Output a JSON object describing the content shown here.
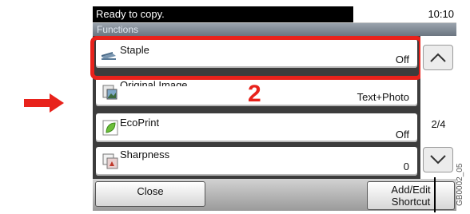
{
  "status": {
    "message": "Ready to copy.",
    "time": "10:10"
  },
  "header": {
    "title": "Functions"
  },
  "items": [
    {
      "label": "Staple",
      "value": "Off",
      "icon": "stapler-icon"
    },
    {
      "label": "Original Image",
      "value": "Text+Photo",
      "icon": "original-image-icon"
    },
    {
      "label": "EcoPrint",
      "value": "Off",
      "icon": "leaf-icon"
    },
    {
      "label": "Sharpness",
      "value": "0",
      "icon": "sharpness-icon"
    }
  ],
  "pager": {
    "indicator": "2/4"
  },
  "buttons": {
    "close": "Close",
    "add_edit_line1": "Add/Edit",
    "add_edit_line2": "Shortcut"
  },
  "annotation": {
    "step": "2",
    "code": "GB0002_05"
  },
  "colors": {
    "highlight": "#e8221b",
    "status_bg": "#000000"
  }
}
